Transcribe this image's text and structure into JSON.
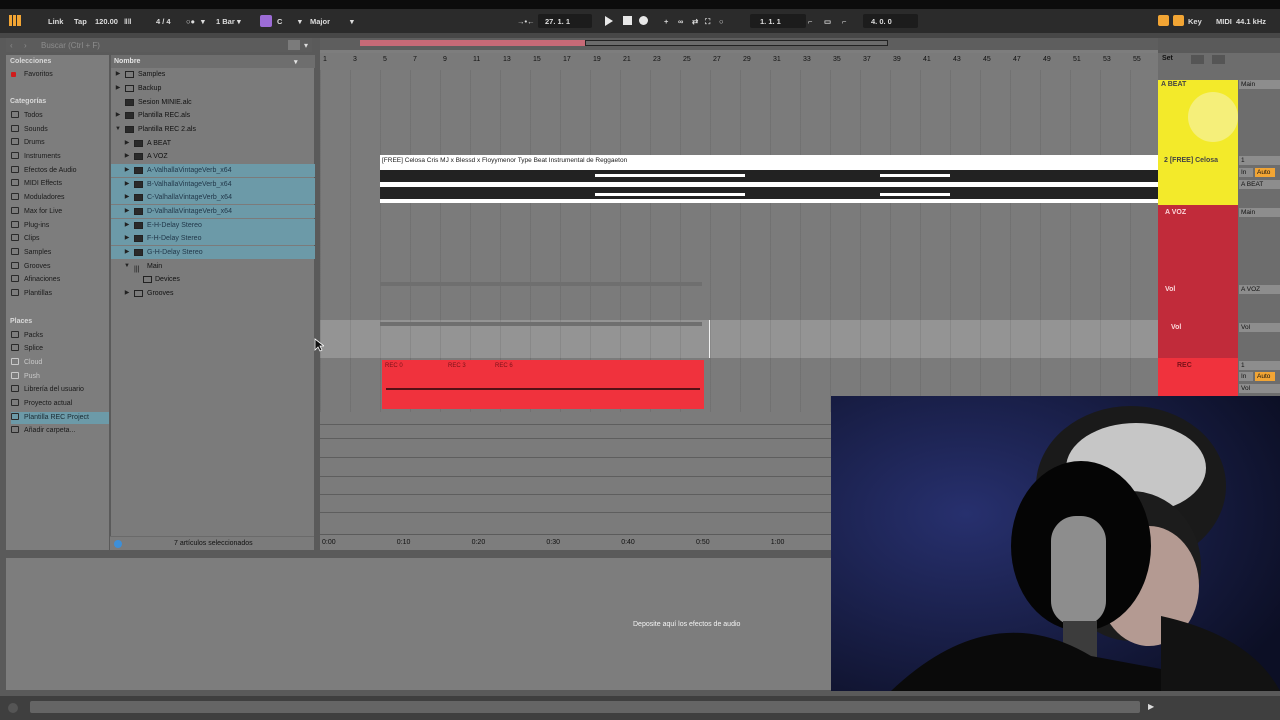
{
  "transport": {
    "link": "Link",
    "tap": "Tap",
    "tempo": "120.00",
    "meter": "4 / 4",
    "quantize": "1 Bar",
    "key_root": "C",
    "scale": "Major",
    "position": "27.  1.  1",
    "loop_start": "1.  1.  1",
    "loop_length": "4.  0.  0",
    "key_label": "Key",
    "midi_label": "MIDI",
    "sample_rate": "44.1 kHz"
  },
  "browser": {
    "search_placeholder": "Buscar (Ctrl + F)",
    "collections_heading": "Colecciones",
    "favorites": "Favoritos",
    "categories_heading": "Categorías",
    "categories": [
      "Todos",
      "Sounds",
      "Drums",
      "Instruments",
      "Efectos de Audio",
      "MIDI Effects",
      "Moduladores",
      "Max for Live",
      "Plug-ins",
      "Clips",
      "Samples",
      "Grooves",
      "Afinaciones",
      "Plantillas"
    ],
    "places_heading": "Places",
    "places": [
      "Packs",
      "Splice",
      "Cloud",
      "Push",
      "Librería del usuario",
      "Proyecto actual",
      "Plantilla REC Project",
      "Añadir carpeta..."
    ],
    "column_header": "Nombre",
    "files": [
      {
        "label": "Samples"
      },
      {
        "label": "Backup"
      },
      {
        "label": "Sesion MINIE.alc"
      },
      {
        "label": "Plantilla REC.als"
      },
      {
        "label": "Plantilla REC 2.als"
      },
      {
        "label": "A BEAT"
      },
      {
        "label": "A VOZ"
      },
      {
        "label": "A-ValhallaVintageVerb_x64"
      },
      {
        "label": "B-ValhallaVintageVerb_x64"
      },
      {
        "label": "C-ValhallaVintageVerb_x64"
      },
      {
        "label": "D-ValhallaVintageVerb_x64"
      },
      {
        "label": "E-H-Delay Stereo"
      },
      {
        "label": "F-H-Delay Stereo"
      },
      {
        "label": "G-H-Delay Stereo"
      },
      {
        "label": "Main"
      },
      {
        "label": "Devices"
      },
      {
        "label": "Grooves"
      }
    ],
    "footer_status": "7 artículos seleccionados"
  },
  "arrangement": {
    "bar_numbers": [
      "1",
      "3",
      "5",
      "7",
      "9",
      "11",
      "13",
      "15",
      "17",
      "19",
      "21",
      "23",
      "25",
      "27",
      "29",
      "31",
      "33",
      "35",
      "37",
      "39",
      "41",
      "43",
      "45",
      "47",
      "49",
      "51",
      "53",
      "55"
    ],
    "beat_clip_name": "[FREE] Celosa Cris MJ x Blessd x Floyymenor Type Beat  Instrumental de Reggaeton",
    "rec_clip_labels": [
      "REC 0",
      "REC 3",
      "REC 6"
    ],
    "time_marks": [
      "0:00",
      "0:10",
      "0:20",
      "0:30",
      "0:40",
      "0:50",
      "1:00"
    ],
    "set_label": "Set"
  },
  "mixer": {
    "tracks": [
      {
        "name": "A BEAT",
        "output": "Main"
      },
      {
        "name": "2 [FREE] Celosa",
        "number": "1",
        "in": "In",
        "auto": "Auto",
        "output": "A BEAT"
      },
      {
        "name": "A VOZ",
        "output": "Main"
      },
      {
        "name": "Vol",
        "output": "A VOZ"
      },
      {
        "name": "Vol",
        "output": "Vol"
      },
      {
        "name": "REC",
        "number": "1",
        "in": "In",
        "auto": "Auto",
        "output": "Vol"
      }
    ]
  },
  "detail": {
    "drop_message": "Deposite aquí los efectos de audio"
  },
  "colors": {
    "beat_yellow": "#f3ea2a",
    "voz_red": "#c12b3a",
    "rec_red": "#f0323d",
    "selection_blue": "#6c9aa8"
  }
}
